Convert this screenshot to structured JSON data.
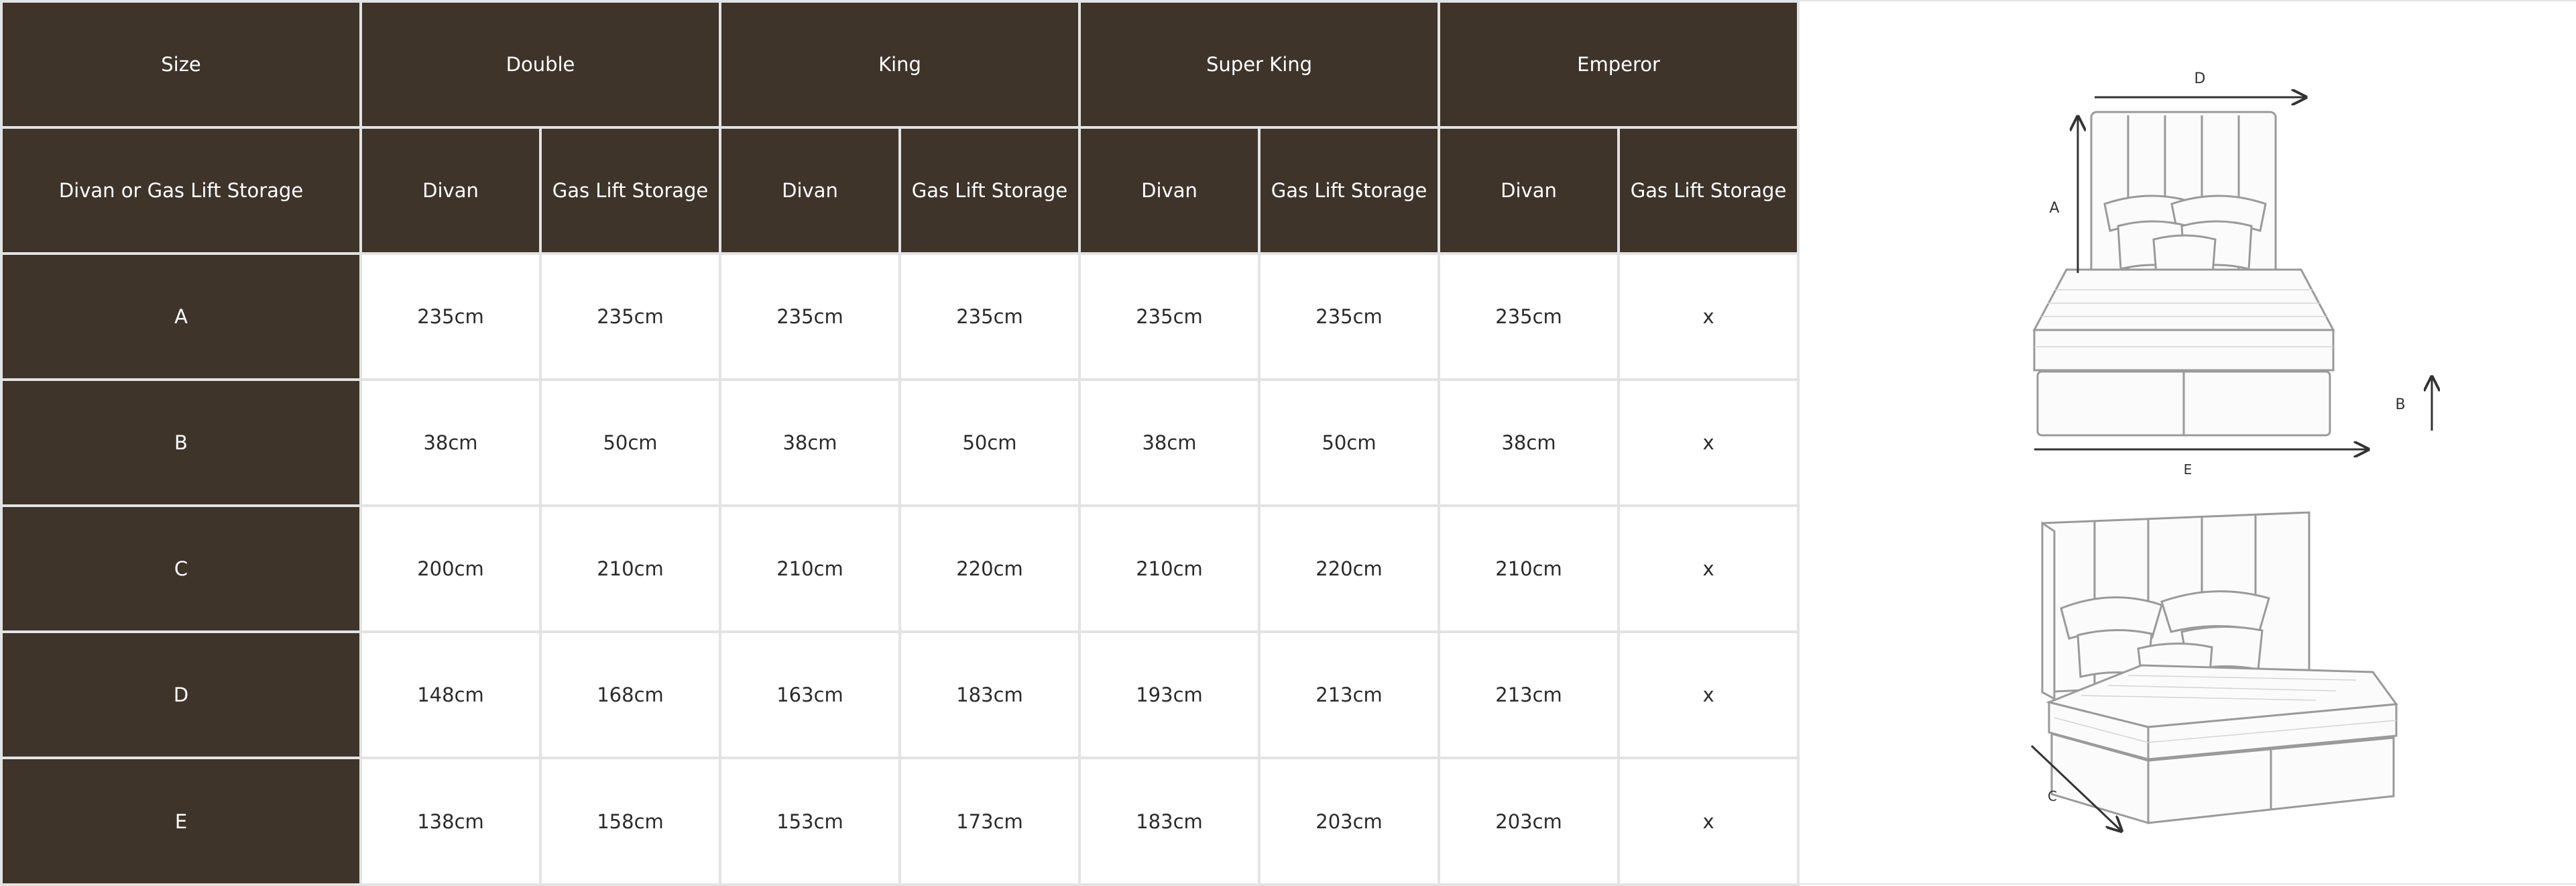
{
  "table": {
    "corner_size": "Size",
    "corner_type": "Divan or Gas Lift Storage",
    "sizes": [
      "Double",
      "King",
      "Super King",
      "Emperor"
    ],
    "types": [
      "Divan",
      "Gas Lift Storage",
      "Divan",
      "Gas Lift Storage",
      "Divan",
      "Gas Lift Storage",
      "Divan",
      "Gas Lift Storage"
    ],
    "rows": [
      {
        "label": "A",
        "values": [
          "235cm",
          "235cm",
          "235cm",
          "235cm",
          "235cm",
          "235cm",
          "235cm",
          "x"
        ]
      },
      {
        "label": "B",
        "values": [
          "38cm",
          "50cm",
          "38cm",
          "50cm",
          "38cm",
          "50cm",
          "38cm",
          "x"
        ]
      },
      {
        "label": "C",
        "values": [
          "200cm",
          "210cm",
          "210cm",
          "220cm",
          "210cm",
          "220cm",
          "210cm",
          "x"
        ]
      },
      {
        "label": "D",
        "values": [
          "148cm",
          "168cm",
          "163cm",
          "183cm",
          "193cm",
          "213cm",
          "213cm",
          "x"
        ]
      },
      {
        "label": "E",
        "values": [
          "138cm",
          "158cm",
          "153cm",
          "173cm",
          "183cm",
          "203cm",
          "203cm",
          "x"
        ]
      }
    ]
  },
  "diagram": {
    "front_labels": {
      "d": "D",
      "a": "A",
      "b": "B",
      "e": "E"
    },
    "side_labels": {
      "c": "C"
    }
  },
  "colors": {
    "header_bg": "#3f342a",
    "header_text": "#ffffff",
    "grid_line": "#e3e3e3",
    "body_text": "#2b2b2b"
  }
}
